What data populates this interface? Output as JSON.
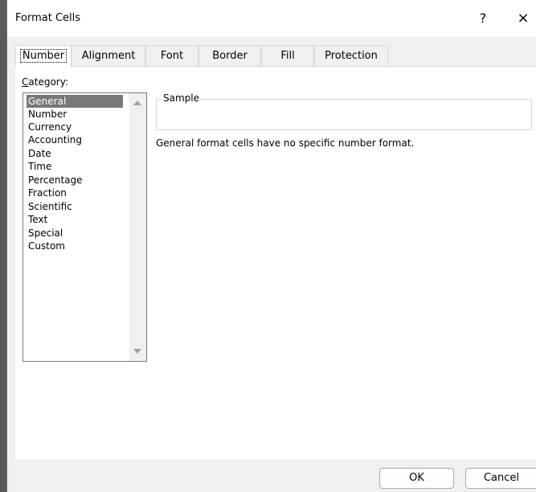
{
  "window": {
    "title": "Format Cells",
    "help_glyph": "?",
    "close_glyph": "×"
  },
  "tabs": [
    {
      "label": "Number",
      "active": true
    },
    {
      "label": "Alignment"
    },
    {
      "label": "Font"
    },
    {
      "label": "Border"
    },
    {
      "label": "Fill"
    },
    {
      "label": "Protection"
    }
  ],
  "number_tab": {
    "category_label_prefix": "C",
    "category_label_rest": "ategory:",
    "categories": [
      "General",
      "Number",
      "Currency",
      "Accounting",
      "Date",
      "Time",
      "Percentage",
      "Fraction",
      "Scientific",
      "Text",
      "Special",
      "Custom"
    ],
    "selected_category": "General",
    "sample_label": "Sample",
    "description": "General format cells have no specific number format."
  },
  "buttons": {
    "ok": "OK",
    "cancel": "Cancel"
  }
}
